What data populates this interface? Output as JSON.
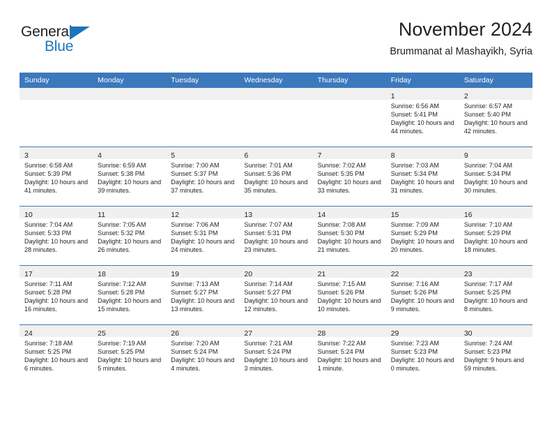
{
  "brand": {
    "name_part1": "General",
    "name_part2": "Blue",
    "accent_color": "#1c75bc"
  },
  "header": {
    "title": "November 2024",
    "subtitle": "Brummanat al Mashayikh, Syria",
    "header_bar_color": "#3c78bc"
  },
  "weekday_headers": [
    "Sunday",
    "Monday",
    "Tuesday",
    "Wednesday",
    "Thursday",
    "Friday",
    "Saturday"
  ],
  "labels": {
    "sunrise_prefix": "Sunrise:",
    "sunset_prefix": "Sunset:",
    "daylight_prefix": "Daylight:"
  },
  "weeks": [
    [
      {
        "day": "",
        "empty": true
      },
      {
        "day": "",
        "empty": true
      },
      {
        "day": "",
        "empty": true
      },
      {
        "day": "",
        "empty": true
      },
      {
        "day": "",
        "empty": true
      },
      {
        "day": "1",
        "sunrise": "Sunrise: 6:56 AM",
        "sunset": "Sunset: 5:41 PM",
        "daylight": "Daylight: 10 hours and 44 minutes."
      },
      {
        "day": "2",
        "sunrise": "Sunrise: 6:57 AM",
        "sunset": "Sunset: 5:40 PM",
        "daylight": "Daylight: 10 hours and 42 minutes."
      }
    ],
    [
      {
        "day": "3",
        "sunrise": "Sunrise: 6:58 AM",
        "sunset": "Sunset: 5:39 PM",
        "daylight": "Daylight: 10 hours and 41 minutes."
      },
      {
        "day": "4",
        "sunrise": "Sunrise: 6:59 AM",
        "sunset": "Sunset: 5:38 PM",
        "daylight": "Daylight: 10 hours and 39 minutes."
      },
      {
        "day": "5",
        "sunrise": "Sunrise: 7:00 AM",
        "sunset": "Sunset: 5:37 PM",
        "daylight": "Daylight: 10 hours and 37 minutes."
      },
      {
        "day": "6",
        "sunrise": "Sunrise: 7:01 AM",
        "sunset": "Sunset: 5:36 PM",
        "daylight": "Daylight: 10 hours and 35 minutes."
      },
      {
        "day": "7",
        "sunrise": "Sunrise: 7:02 AM",
        "sunset": "Sunset: 5:35 PM",
        "daylight": "Daylight: 10 hours and 33 minutes."
      },
      {
        "day": "8",
        "sunrise": "Sunrise: 7:03 AM",
        "sunset": "Sunset: 5:34 PM",
        "daylight": "Daylight: 10 hours and 31 minutes."
      },
      {
        "day": "9",
        "sunrise": "Sunrise: 7:04 AM",
        "sunset": "Sunset: 5:34 PM",
        "daylight": "Daylight: 10 hours and 30 minutes."
      }
    ],
    [
      {
        "day": "10",
        "sunrise": "Sunrise: 7:04 AM",
        "sunset": "Sunset: 5:33 PM",
        "daylight": "Daylight: 10 hours and 28 minutes."
      },
      {
        "day": "11",
        "sunrise": "Sunrise: 7:05 AM",
        "sunset": "Sunset: 5:32 PM",
        "daylight": "Daylight: 10 hours and 26 minutes."
      },
      {
        "day": "12",
        "sunrise": "Sunrise: 7:06 AM",
        "sunset": "Sunset: 5:31 PM",
        "daylight": "Daylight: 10 hours and 24 minutes."
      },
      {
        "day": "13",
        "sunrise": "Sunrise: 7:07 AM",
        "sunset": "Sunset: 5:31 PM",
        "daylight": "Daylight: 10 hours and 23 minutes."
      },
      {
        "day": "14",
        "sunrise": "Sunrise: 7:08 AM",
        "sunset": "Sunset: 5:30 PM",
        "daylight": "Daylight: 10 hours and 21 minutes."
      },
      {
        "day": "15",
        "sunrise": "Sunrise: 7:09 AM",
        "sunset": "Sunset: 5:29 PM",
        "daylight": "Daylight: 10 hours and 20 minutes."
      },
      {
        "day": "16",
        "sunrise": "Sunrise: 7:10 AM",
        "sunset": "Sunset: 5:29 PM",
        "daylight": "Daylight: 10 hours and 18 minutes."
      }
    ],
    [
      {
        "day": "17",
        "sunrise": "Sunrise: 7:11 AM",
        "sunset": "Sunset: 5:28 PM",
        "daylight": "Daylight: 10 hours and 16 minutes."
      },
      {
        "day": "18",
        "sunrise": "Sunrise: 7:12 AM",
        "sunset": "Sunset: 5:28 PM",
        "daylight": "Daylight: 10 hours and 15 minutes."
      },
      {
        "day": "19",
        "sunrise": "Sunrise: 7:13 AM",
        "sunset": "Sunset: 5:27 PM",
        "daylight": "Daylight: 10 hours and 13 minutes."
      },
      {
        "day": "20",
        "sunrise": "Sunrise: 7:14 AM",
        "sunset": "Sunset: 5:27 PM",
        "daylight": "Daylight: 10 hours and 12 minutes."
      },
      {
        "day": "21",
        "sunrise": "Sunrise: 7:15 AM",
        "sunset": "Sunset: 5:26 PM",
        "daylight": "Daylight: 10 hours and 10 minutes."
      },
      {
        "day": "22",
        "sunrise": "Sunrise: 7:16 AM",
        "sunset": "Sunset: 5:26 PM",
        "daylight": "Daylight: 10 hours and 9 minutes."
      },
      {
        "day": "23",
        "sunrise": "Sunrise: 7:17 AM",
        "sunset": "Sunset: 5:25 PM",
        "daylight": "Daylight: 10 hours and 8 minutes."
      }
    ],
    [
      {
        "day": "24",
        "sunrise": "Sunrise: 7:18 AM",
        "sunset": "Sunset: 5:25 PM",
        "daylight": "Daylight: 10 hours and 6 minutes."
      },
      {
        "day": "25",
        "sunrise": "Sunrise: 7:19 AM",
        "sunset": "Sunset: 5:25 PM",
        "daylight": "Daylight: 10 hours and 5 minutes."
      },
      {
        "day": "26",
        "sunrise": "Sunrise: 7:20 AM",
        "sunset": "Sunset: 5:24 PM",
        "daylight": "Daylight: 10 hours and 4 minutes."
      },
      {
        "day": "27",
        "sunrise": "Sunrise: 7:21 AM",
        "sunset": "Sunset: 5:24 PM",
        "daylight": "Daylight: 10 hours and 3 minutes."
      },
      {
        "day": "28",
        "sunrise": "Sunrise: 7:22 AM",
        "sunset": "Sunset: 5:24 PM",
        "daylight": "Daylight: 10 hours and 1 minute."
      },
      {
        "day": "29",
        "sunrise": "Sunrise: 7:23 AM",
        "sunset": "Sunset: 5:23 PM",
        "daylight": "Daylight: 10 hours and 0 minutes."
      },
      {
        "day": "30",
        "sunrise": "Sunrise: 7:24 AM",
        "sunset": "Sunset: 5:23 PM",
        "daylight": "Daylight: 9 hours and 59 minutes."
      }
    ]
  ]
}
